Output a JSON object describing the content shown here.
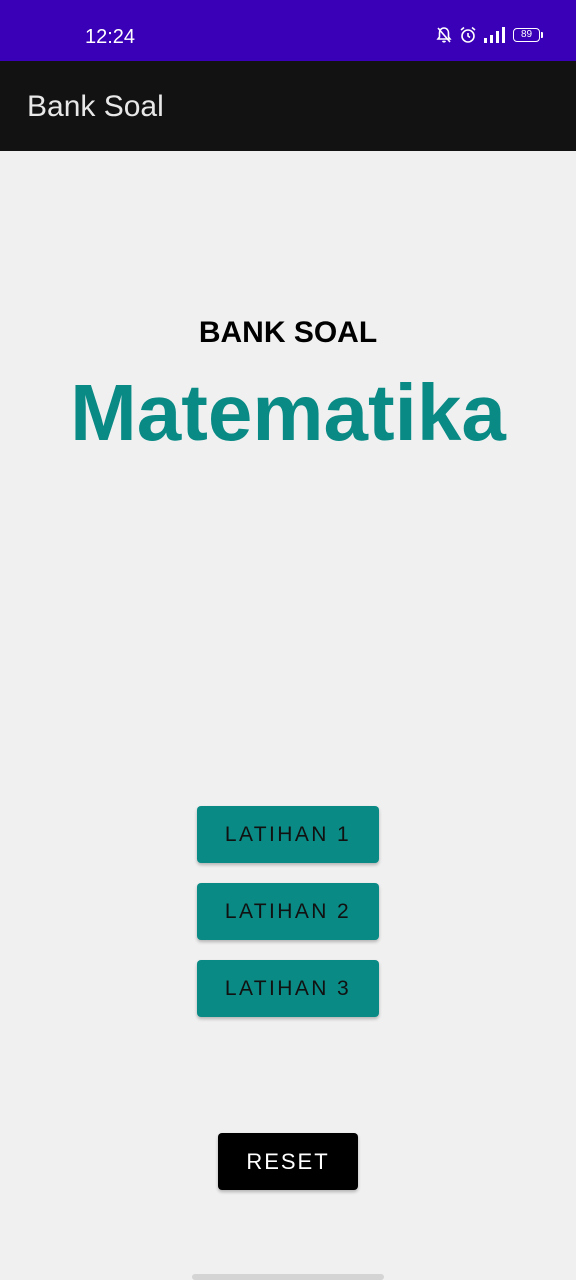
{
  "status_bar": {
    "time": "12:24",
    "battery": "89",
    "background": "#3a00b8",
    "icons": [
      "bell-off-icon",
      "alarm-icon",
      "signal-icon",
      "battery-icon"
    ]
  },
  "app_bar": {
    "title": "Bank Soal",
    "background": "#121212"
  },
  "header": {
    "subtitle": "BANK SOAL",
    "title": "Matematika",
    "title_color": "#0a8a85"
  },
  "buttons": {
    "latihan": [
      {
        "label": "LATIHAN 1"
      },
      {
        "label": "LATIHAN 2"
      },
      {
        "label": "LATIHAN 3"
      }
    ],
    "latihan_color": "#0a8a85",
    "reset_label": "RESET",
    "reset_color": "#000000"
  }
}
